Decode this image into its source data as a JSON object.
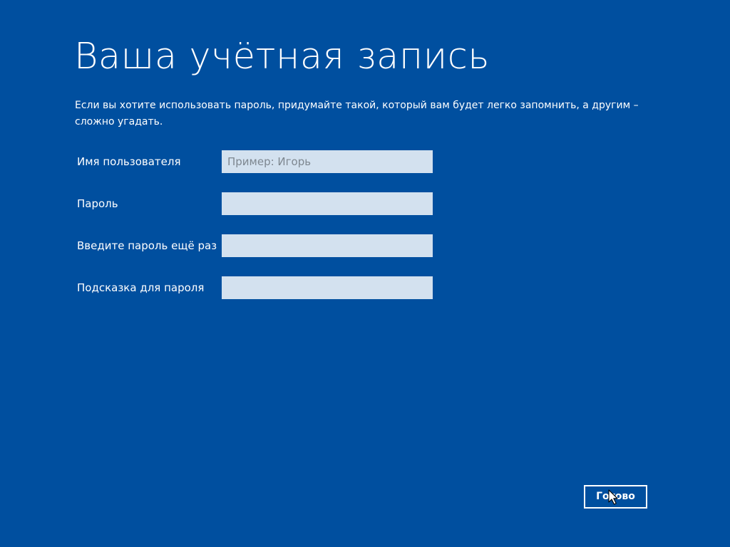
{
  "page": {
    "title": "Ваша учётная запись",
    "description": "Если вы хотите использовать пароль, придумайте такой, который вам будет легко запомнить, а другим – сложно угадать."
  },
  "form": {
    "username": {
      "label": "Имя пользователя",
      "placeholder": "Пример: Игорь",
      "value": ""
    },
    "password": {
      "label": "Пароль",
      "placeholder": "",
      "value": ""
    },
    "confirm_password": {
      "label": "Введите пароль ещё раз",
      "placeholder": "",
      "value": ""
    },
    "password_hint": {
      "label": "Подсказка для пароля",
      "placeholder": "",
      "value": ""
    }
  },
  "actions": {
    "done_label": "Готово"
  },
  "colors": {
    "background": "#004f9f",
    "input_background": "#d3e1ef",
    "text": "#ffffff"
  },
  "icons": {
    "cursor": "mouse-pointer-icon"
  }
}
